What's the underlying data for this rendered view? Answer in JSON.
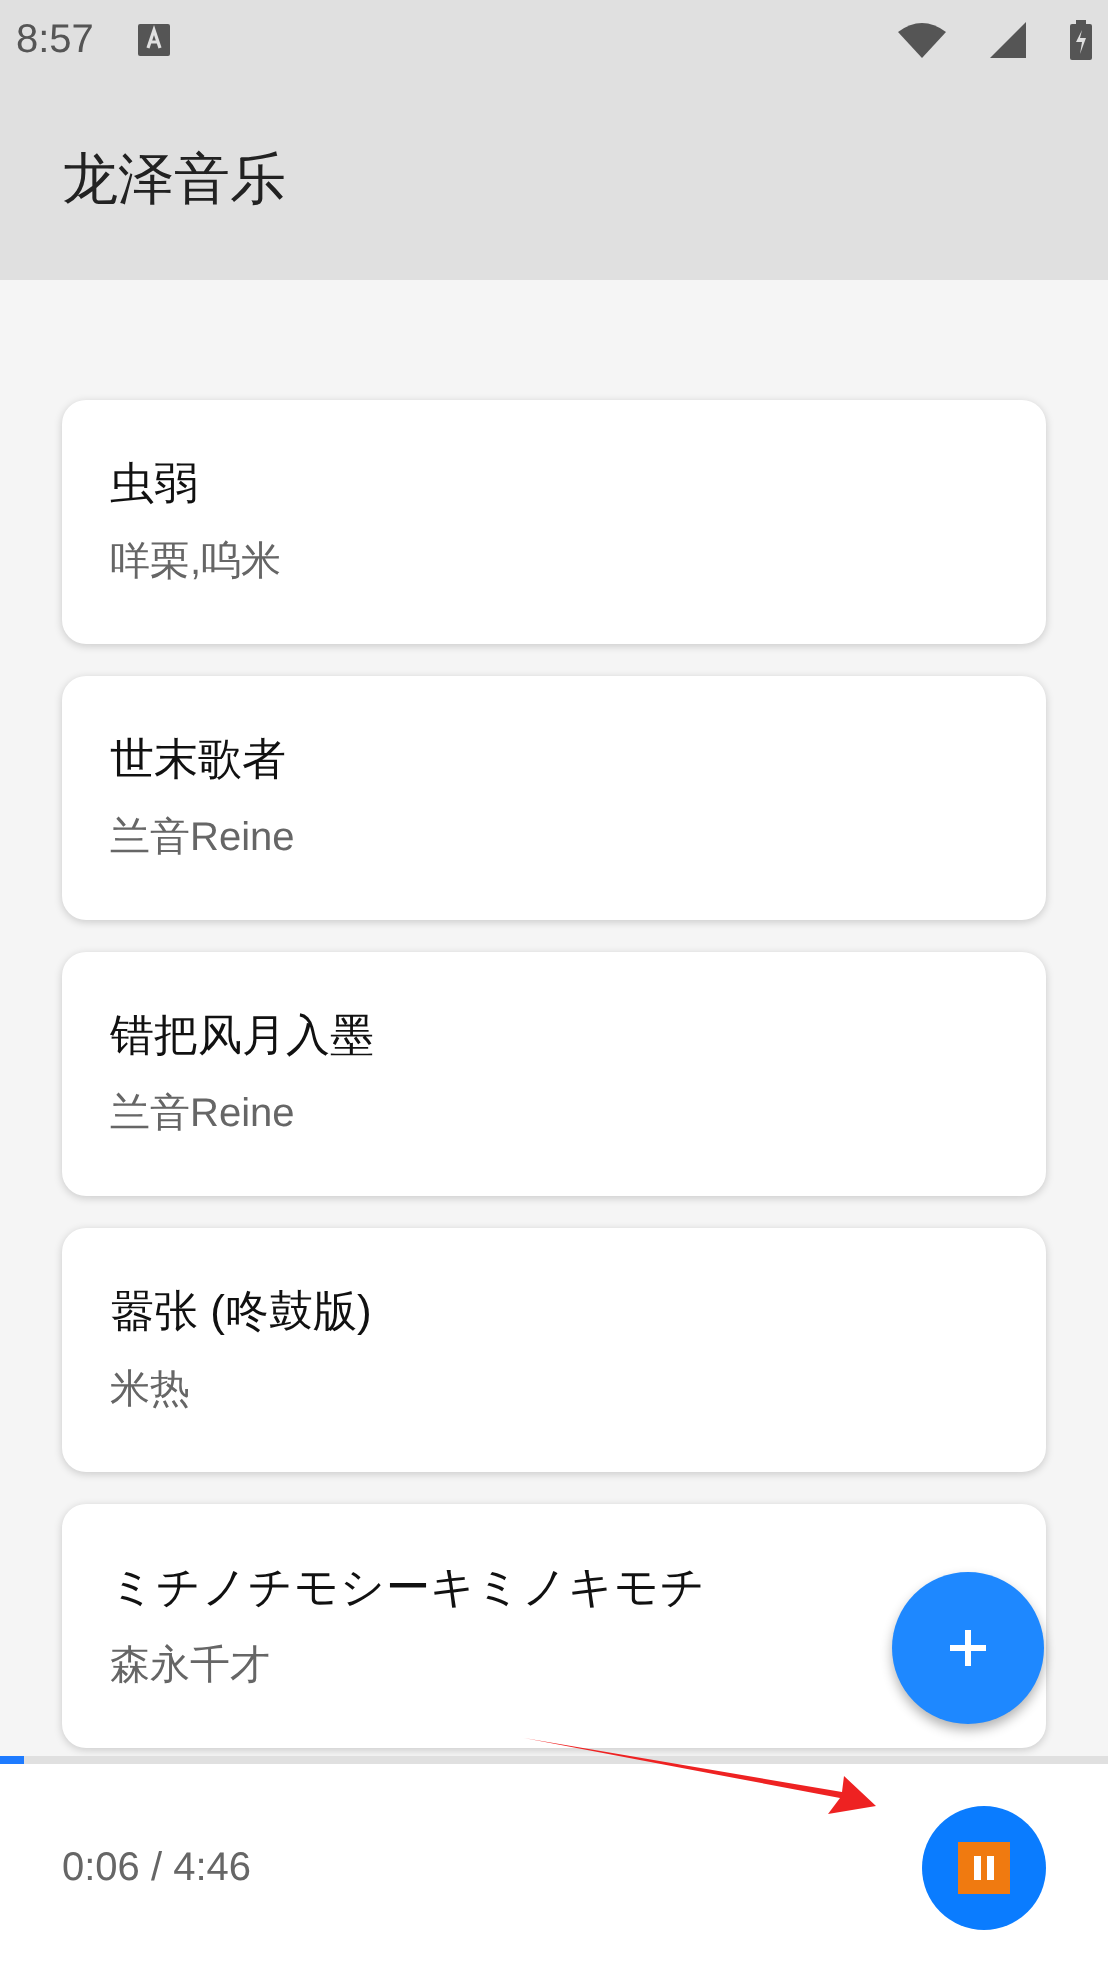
{
  "status_bar": {
    "time": "8:57"
  },
  "app_bar": {
    "title": "龙泽音乐"
  },
  "songs": [
    {
      "title": "虫弱",
      "artist": "咩栗,呜米"
    },
    {
      "title": "世末歌者",
      "artist": "兰音Reine"
    },
    {
      "title": "错把风月入墨",
      "artist": "兰音Reine"
    },
    {
      "title": "嚣张 (咚鼓版)",
      "artist": "米热"
    },
    {
      "title": "ミチノチモシーキミノキモチ",
      "artist": "森永千才"
    }
  ],
  "player": {
    "level": 0.021,
    "time": "0:06 / 4:46",
    "playing": true
  }
}
